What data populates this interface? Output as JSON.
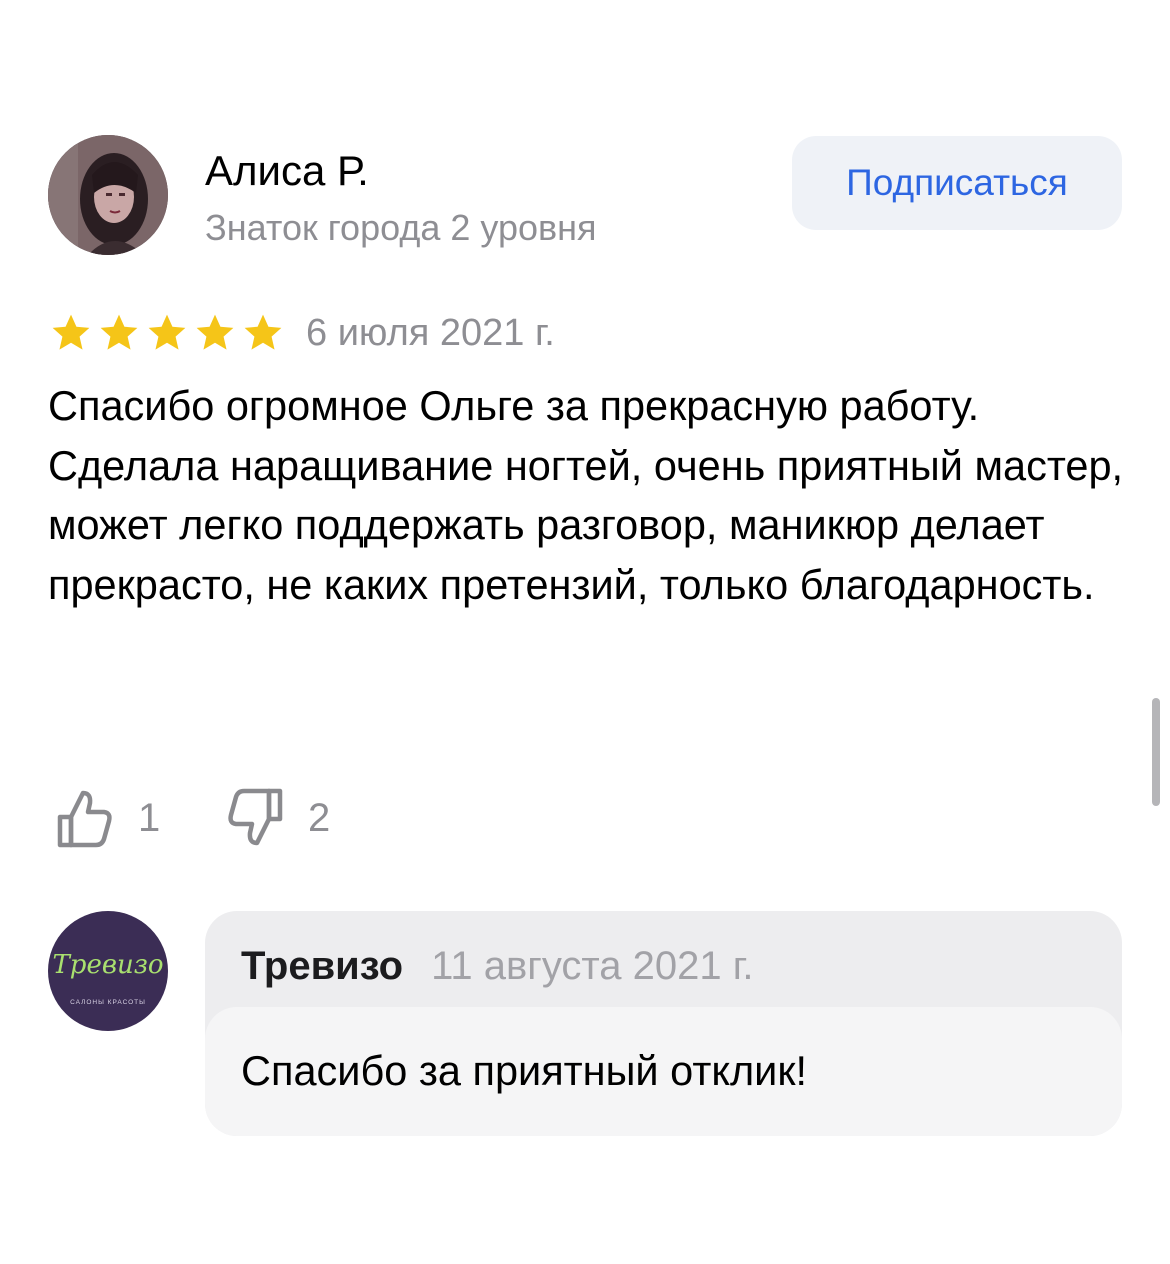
{
  "review": {
    "author": {
      "name": "Алиса Р.",
      "level": "Знаток города 2 уровня",
      "avatar_icon": "user-photo"
    },
    "subscribe_label": "Подписаться",
    "rating": 5,
    "rating_max": 5,
    "date": "6 июля 2021 г.",
    "text": [
      "Спасибо огромное Ольге за прекрасную работу.",
      "Сделала наращивание ногтей, очень приятный мастер, может легко поддержать разговор, маникюр делает прекрасто, не каких претензий, только благодарность."
    ],
    "likes": "1",
    "dislikes": "2"
  },
  "reply": {
    "logo_text": "Тревизо",
    "logo_subtext": "САЛОНЫ КРАСОТЫ",
    "author": "Тревизо",
    "date": "11 августа 2021 г.",
    "text": "Спасибо за приятный отклик!"
  },
  "colors": {
    "accent": "#2d66e2",
    "star": "#f5c518",
    "muted_text": "#8e8e93",
    "button_bg": "#eff2f7",
    "reply_bg": "#ededef",
    "reply_body_bg": "#f5f5f6",
    "logo_bg": "#3b2d55",
    "logo_text": "#a9e06f"
  },
  "icons": {
    "like": "thumbs-up-icon",
    "dislike": "thumbs-down-icon",
    "star": "star-icon"
  }
}
